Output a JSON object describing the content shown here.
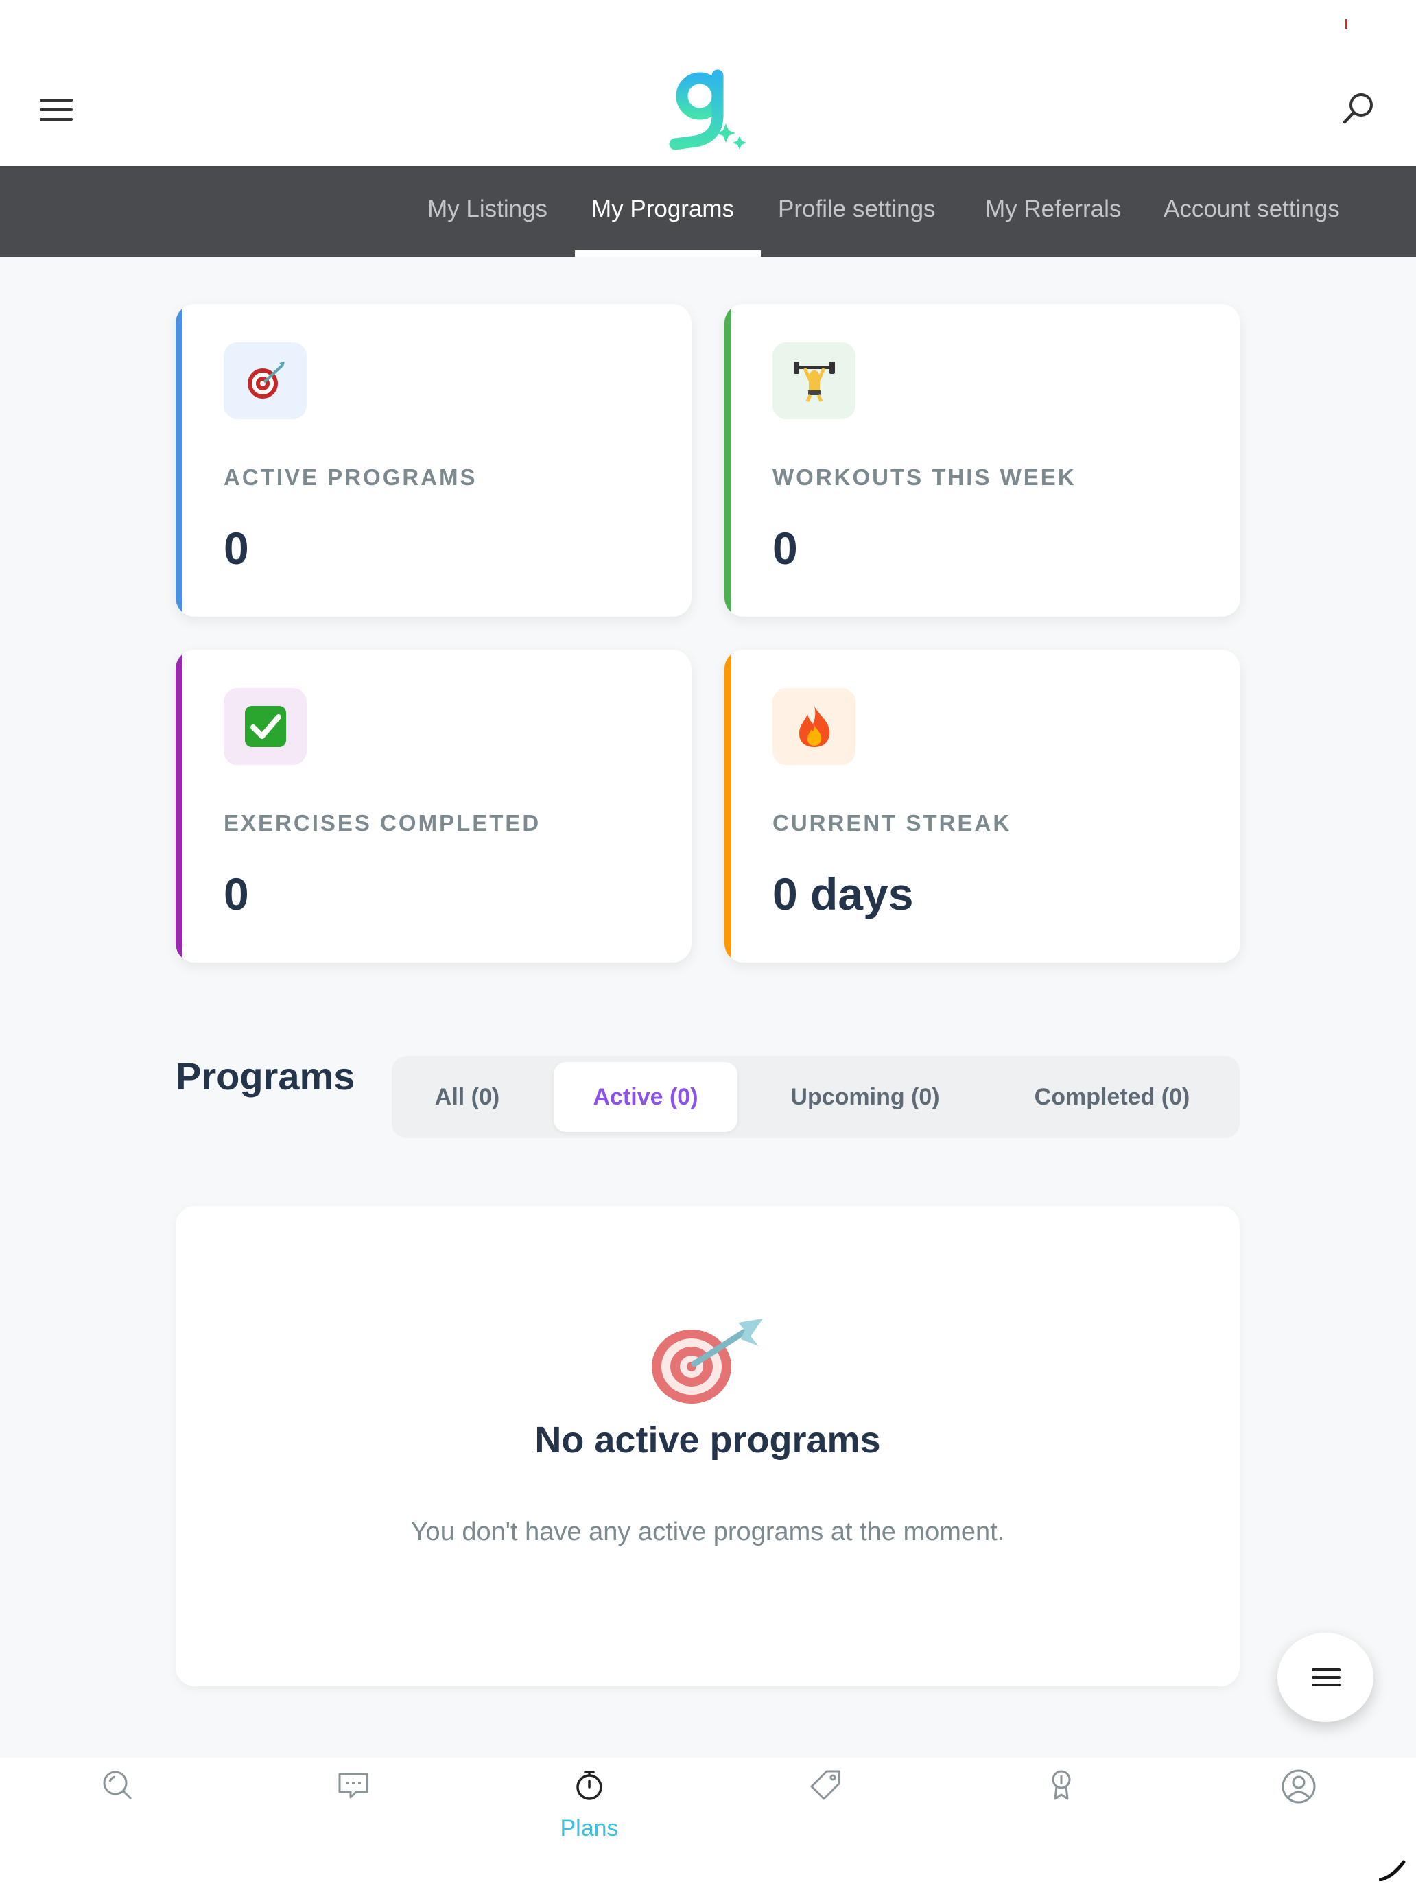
{
  "header": {
    "menu_icon": "hamburger-icon",
    "logo_icon": "g-sparkle-logo-icon",
    "search_icon": "search-icon"
  },
  "nav": {
    "tabs": [
      {
        "label": "My Listings",
        "active": false
      },
      {
        "label": "My Programs",
        "active": true
      },
      {
        "label": "Profile settings",
        "active": false
      },
      {
        "label": "My Referrals",
        "active": false
      },
      {
        "label": "Account settings",
        "active": false
      }
    ]
  },
  "stats": [
    {
      "label": "ACTIVE PROGRAMS",
      "value": "0",
      "icon": "🎯",
      "accent": "#4a90e2",
      "icon_bg": "#eaf2fd"
    },
    {
      "label": "WORKOUTS THIS WEEK",
      "value": "0",
      "icon": "🏋",
      "accent": "#4caf50",
      "icon_bg": "#eaf6ec"
    },
    {
      "label": "EXERCISES COMPLETED",
      "value": "0",
      "icon": "✅",
      "accent": "#9c27b0",
      "icon_bg": "#f5e8f7"
    },
    {
      "label": "CURRENT STREAK",
      "value": "0 days",
      "icon": "🔥",
      "accent": "#ff9800",
      "icon_bg": "#fff1e3"
    }
  ],
  "programs": {
    "title": "Programs",
    "filters": [
      {
        "label": "All (0)",
        "active": false
      },
      {
        "label": "Active (0)",
        "active": true
      },
      {
        "label": "Upcoming (0)",
        "active": false
      },
      {
        "label": "Completed (0)",
        "active": false
      }
    ],
    "empty": {
      "icon": "🎯",
      "title": "No active programs",
      "text": "You don't have any active programs at the moment."
    }
  },
  "fab": {
    "icon": "hamburger-icon"
  },
  "bottom_nav": [
    {
      "icon": "search-icon",
      "label": ""
    },
    {
      "icon": "chat-icon",
      "label": ""
    },
    {
      "icon": "timer-icon",
      "label": "Plans",
      "active": true
    },
    {
      "icon": "tag-icon",
      "label": ""
    },
    {
      "icon": "award-icon",
      "label": ""
    },
    {
      "icon": "user-icon",
      "label": ""
    }
  ],
  "colors": {
    "nav_bg": "#4a4b4f",
    "accent_purple": "#8d52e8",
    "accent_cyan": "#3ac0e4",
    "text_dark": "#24344a",
    "text_muted": "#7c8a8f"
  }
}
